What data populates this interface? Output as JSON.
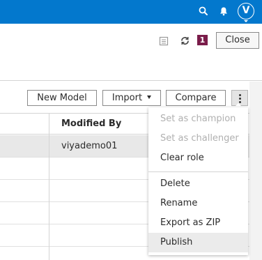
{
  "topbar": {
    "color": "#0378cd",
    "icons": [
      "search-icon",
      "bell-icon"
    ],
    "avatar_letter": "V"
  },
  "header": {
    "icons": [
      "document-icon",
      "refresh-icon"
    ],
    "badge_count": "1",
    "badge_color": "#7a1c4a",
    "close_label": "Close"
  },
  "toolbar": {
    "new_model_label": "New Model",
    "import_label": "Import",
    "compare_label": "Compare",
    "more_icon": "kebab-icon"
  },
  "table": {
    "columns": [
      "Modified By"
    ],
    "rows": [
      {
        "modified_by": "viyademo01",
        "selected": true
      },
      {
        "modified_by": ""
      },
      {
        "modified_by": ""
      },
      {
        "modified_by": ""
      },
      {
        "modified_by": ""
      }
    ]
  },
  "menu": {
    "items": [
      {
        "label": "Set as champion",
        "disabled": true
      },
      {
        "label": "Set as challenger",
        "disabled": true
      },
      {
        "label": "Clear role",
        "disabled": false
      },
      {
        "label": "Delete",
        "disabled": false
      },
      {
        "label": "Rename",
        "disabled": false
      },
      {
        "label": "Export as ZIP",
        "disabled": false
      },
      {
        "label": "Publish",
        "disabled": false,
        "hovered": true
      }
    ]
  }
}
